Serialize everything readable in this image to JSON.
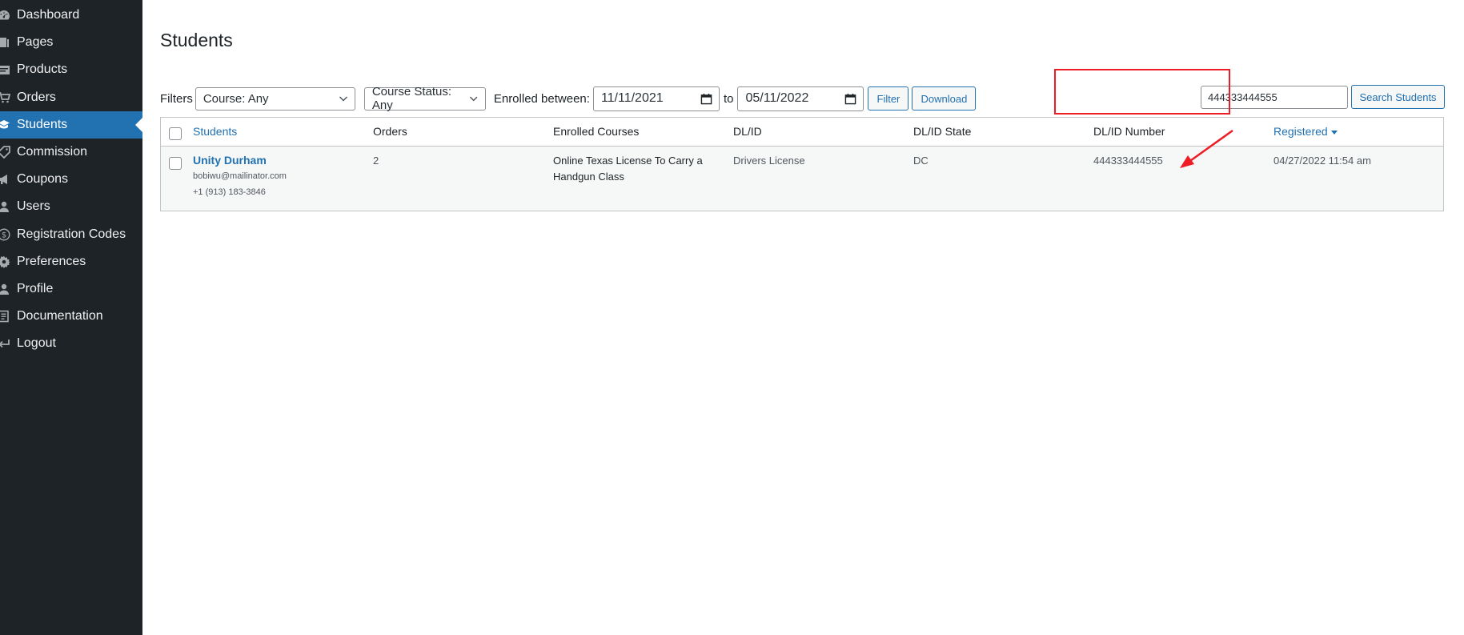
{
  "sidebar": {
    "items": [
      {
        "label": "Dashboard",
        "icon": "dashboard-icon"
      },
      {
        "label": "Pages",
        "icon": "pages-icon"
      },
      {
        "label": "Products",
        "icon": "products-icon"
      },
      {
        "label": "Orders",
        "icon": "cart-icon"
      },
      {
        "label": "Students",
        "icon": "students-icon",
        "active": true
      },
      {
        "label": "Commission",
        "icon": "tag-icon"
      },
      {
        "label": "Coupons",
        "icon": "megaphone-icon"
      },
      {
        "label": "Users",
        "icon": "user-icon"
      },
      {
        "label": "Registration Codes",
        "icon": "dollar-icon"
      },
      {
        "label": "Preferences",
        "icon": "gear-icon"
      },
      {
        "label": "Profile",
        "icon": "profile-icon"
      },
      {
        "label": "Documentation",
        "icon": "document-icon"
      },
      {
        "label": "Logout",
        "icon": "logout-icon"
      }
    ]
  },
  "page": {
    "title": "Students"
  },
  "filters": {
    "label": "Filters",
    "course": "Course: Any",
    "course_status": "Course Status: Any",
    "enrolled_label": "Enrolled between:",
    "date_from": "11/11/2021",
    "to_label": "to",
    "date_to": "05/11/2022",
    "filter_button": "Filter",
    "download_button": "Download"
  },
  "search": {
    "value": "444333444555",
    "button": "Search Students"
  },
  "table": {
    "headers": {
      "students": "Students",
      "orders": "Orders",
      "enrolled_courses": "Enrolled Courses",
      "dl_id": "DL/ID",
      "dl_id_state": "DL/ID State",
      "dl_id_number": "DL/ID Number",
      "registered": "Registered"
    },
    "rows": [
      {
        "name": "Unity Durham",
        "email": "bobiwu@mailinator.com",
        "phone": "+1 (913) 183-3846",
        "orders": "2",
        "course_line1": "Online Texas License To Carry a",
        "course_line2": "Handgun Class",
        "dl_id": "Drivers License",
        "dl_state": "DC",
        "dl_number": "444333444555",
        "registered": "04/27/2022 11:54 am"
      }
    ]
  },
  "colors": {
    "sidebar_bg": "#1d2327",
    "accent": "#2271b1",
    "annotation": "#ee1c24"
  }
}
